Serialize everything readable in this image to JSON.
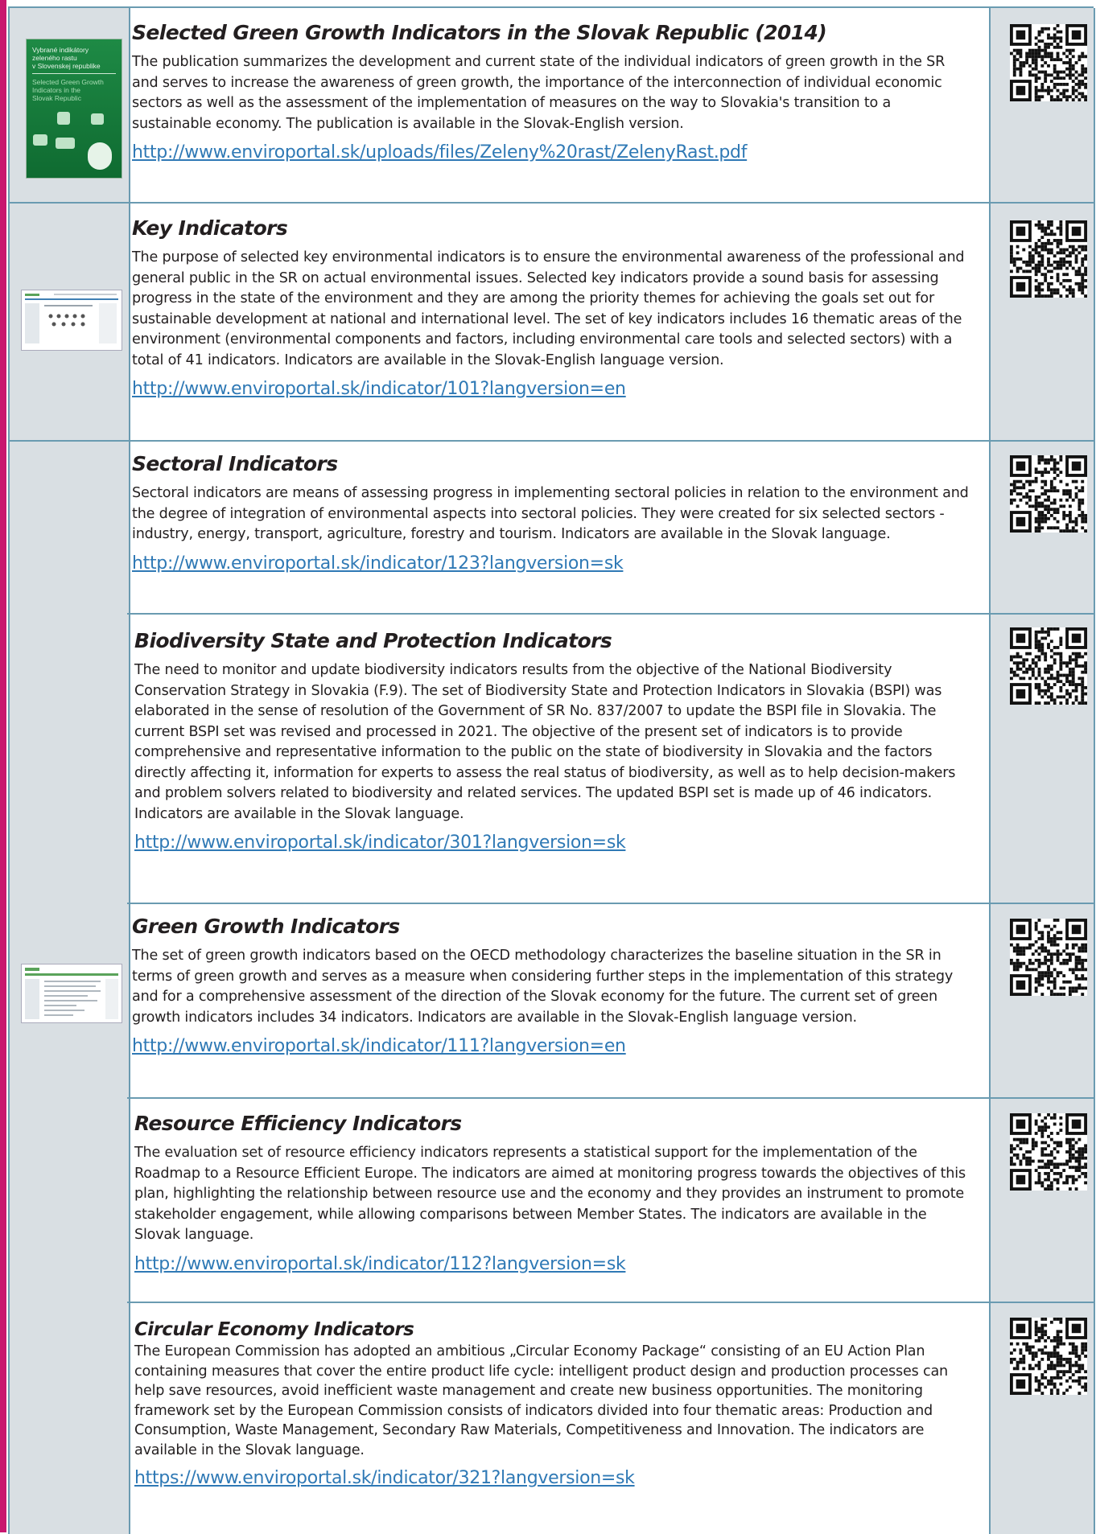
{
  "entries": [
    {
      "title": "Selected Green Growth Indicators in the Slovak Republic (2014)",
      "text": "The publication summarizes the development and current state of the individual indicators of green growth in the SR and serves to increase the awareness of green growth, the importance of the interconnection of individual economic sectors as well as the assessment of the implementation of measures on the way to Slovakia's transition to a sustainable economy. The publication is available in the Slovak-English version.",
      "url": "http://www.enviroportal.sk/uploads/files/Zeleny%20rast/ZelenyRast.pdf"
    },
    {
      "title": "Key Indicators",
      "text": "The purpose of selected key environmental indicators is to ensure the environmental awareness of the professional and general public in the SR on actual environmental issues. Selected key indicators provide a sound basis for assessing progress in the state of the environment and they are among the priority themes for achieving the goals set out for sustainable development at national and international level. The set of key indicators includes 16 thematic areas of the environment (environmental components and factors, including environmental care tools and selected sectors) with a total of 41 indicators. Indicators are available in the Slovak-English language version.",
      "url": "http://www.enviroportal.sk/indicator/101?langversion=en"
    },
    {
      "title": "Sectoral Indicators",
      "text": "Sectoral indicators are means of assessing progress in implementing sectoral policies in relation to the environment and the degree of integration of environmental aspects into sectoral policies. They were created for six selected sectors - industry, energy, transport, agriculture, forestry and tourism. Indicators are available in the Slovak language.",
      "url": "http://www.enviroportal.sk/indicator/123?langversion=sk"
    },
    {
      "title": "Biodiversity State and Protection Indicators",
      "text": "The need to monitor and update biodiversity indicators results from the objective of the National Biodiversity Conservation Strategy in Slovakia (F.9). The set of Biodiversity State and Protection Indicators in Slovakia (BSPI) was elaborated in the sense of resolution of the Government of SR No. 837/2007 to update the BSPI file in Slovakia. The current BSPI set was revised and processed in 2021. The objective of the present set of indicators is to provide comprehensive and representative information to the public on the state of biodiversity in Slovakia and the factors directly affecting it, information for experts to assess the real status of biodiversity, as well as to help decision-makers and problem solvers related to biodiversity and related services. The updated BSPI set is made up of 46 indicators. Indicators are available in the Slovak language.",
      "url": "http://www.enviroportal.sk/indicator/301?langversion=sk"
    },
    {
      "title": "Green Growth Indicators",
      "text": "The set of green growth indicators based on the OECD methodology characterizes the baseline situation in the SR in terms of green growth and serves as a measure when considering further steps in the implementation of this strategy and for a comprehensive assessment of the direction of the Slovak economy for the future. The current set of green growth indicators includes 34 indicators. Indicators are available in the Slovak-English language version.",
      "url": "http://www.enviroportal.sk/indicator/111?langversion=en"
    },
    {
      "title": "Resource Efficiency Indicators",
      "text": "The evaluation set of resource efficiency indicators represents a statistical support for the implementation of the Roadmap to a Resource Efficient Europe. The indicators are aimed at monitoring progress towards the objectives of this plan, highlighting the relationship between resource use and the economy and they provides an instrument to promote stakeholder engagement, while allowing comparisons between Member States. The indicators are available in the Slovak language.",
      "url": "http://www.enviroportal.sk/indicator/112?langversion=sk"
    },
    {
      "title": "Circular Economy Indicators",
      "text": "The European Commission has adopted an ambitious „Circular Economy Package“ consisting of an EU Action Plan containing measures that cover the entire product life cycle: intelligent product design and production processes can help save resources, avoid inefficient waste management and create new business opportunities. The monitoring framework set by the European Commission consists of indicators divided into four thematic areas: Production and Consumption, Waste Management, Secondary Raw Materials, Competitiveness and Innovation. The indicators are available in the Slovak language.",
      "url": "https://www.enviroportal.sk/indicator/321?langversion=sk"
    }
  ],
  "cover": {
    "title_sk": [
      "Vybrané indikátory",
      "zeleného rastu",
      "v Slovenskej republike"
    ],
    "title_en": [
      "Selected Green Growth",
      "Indicators in the",
      "Slovak Republic"
    ]
  },
  "colors": {
    "accent": "#c8176f",
    "border": "#6a9bb1",
    "sidebar": "#d9dfe3",
    "link": "#2f79b5"
  }
}
